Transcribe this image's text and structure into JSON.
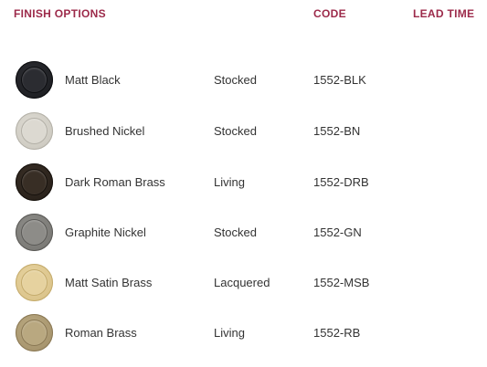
{
  "header": {
    "finish_options": "FINISH OPTIONS",
    "code": "CODE",
    "lead_time": "LEAD TIME"
  },
  "colors": {
    "header_accent": "#9c2a4a",
    "text": "#333333"
  },
  "rows": [
    {
      "name": "Matt Black",
      "finish": "Stocked",
      "code": "1552-BLK",
      "swatch_icon": "matt-black-swatch-icon",
      "swatch_outer": "#1f2024",
      "swatch_inner": "#2b2c31",
      "swatch_edge": "#0c0d10"
    },
    {
      "name": "Brushed Nickel",
      "finish": "Stocked",
      "code": "1552-BN",
      "swatch_icon": "brushed-nickel-swatch-icon",
      "swatch_outer": "#cfccc3",
      "swatch_inner": "#dcd9d1",
      "swatch_edge": "#b3b0a7"
    },
    {
      "name": "Dark Roman Brass",
      "finish": "Living",
      "code": "1552-DRB",
      "swatch_icon": "dark-roman-brass-swatch-icon",
      "swatch_outer": "#2b231c",
      "swatch_inner": "#382e25",
      "swatch_edge": "#16110c"
    },
    {
      "name": "Graphite Nickel",
      "finish": "Stocked",
      "code": "1552-GN",
      "swatch_icon": "graphite-nickel-swatch-icon",
      "swatch_outer": "#7c7b77",
      "swatch_inner": "#8d8c88",
      "swatch_edge": "#5a5956"
    },
    {
      "name": "Matt Satin Brass",
      "finish": "Lacquered",
      "code": "1552-MSB",
      "swatch_icon": "matt-satin-brass-swatch-icon",
      "swatch_outer": "#dcc58c",
      "swatch_inner": "#e6d29f",
      "swatch_edge": "#c4ab6c"
    },
    {
      "name": "Roman Brass",
      "finish": "Living",
      "code": "1552-RB",
      "swatch_icon": "roman-brass-swatch-icon",
      "swatch_outer": "#a8966f",
      "swatch_inner": "#b9a880",
      "swatch_edge": "#8a7854"
    }
  ]
}
